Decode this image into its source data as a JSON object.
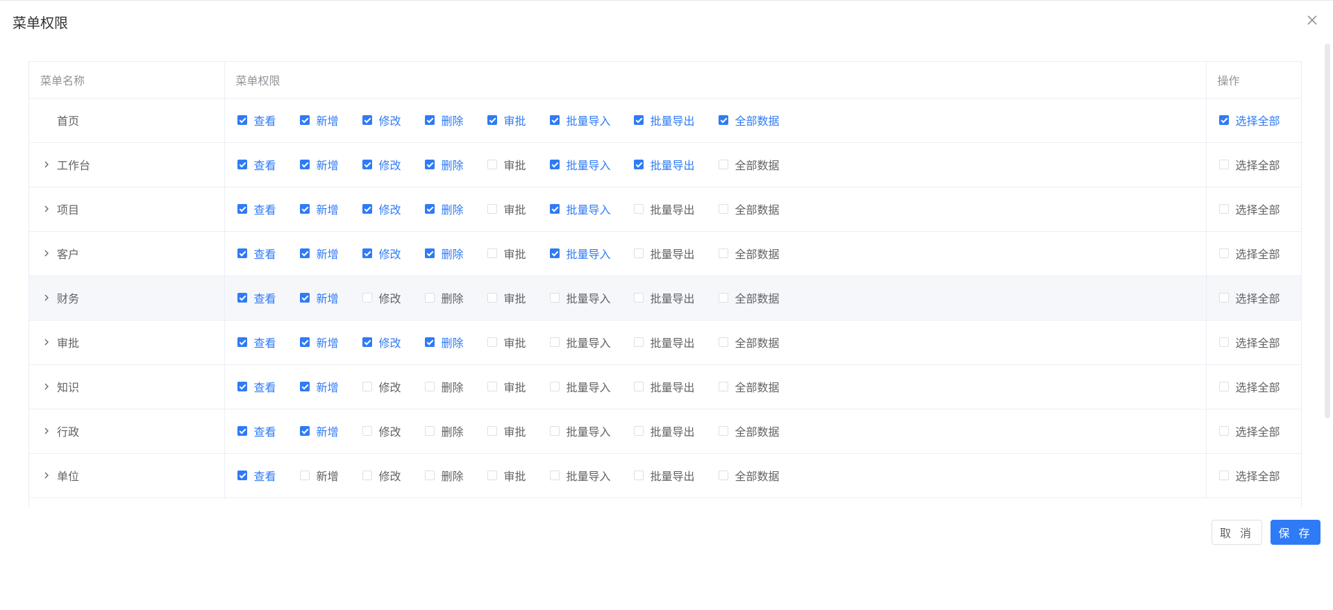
{
  "dialog": {
    "title": "菜单权限"
  },
  "table": {
    "headers": {
      "name": "菜单名称",
      "permissions": "菜单权限",
      "operation": "操作"
    },
    "perm_offsets": [
      0,
      90,
      180,
      270,
      360,
      450,
      571,
      693
    ],
    "rows": [
      {
        "name": "首页",
        "expandable": false,
        "highlight": false,
        "select_all": true,
        "perms": [
          {
            "label": "查看",
            "checked": true
          },
          {
            "label": "新增",
            "checked": true
          },
          {
            "label": "修改",
            "checked": true
          },
          {
            "label": "删除",
            "checked": true
          },
          {
            "label": "审批",
            "checked": true
          },
          {
            "label": "批量导入",
            "checked": true
          },
          {
            "label": "批量导出",
            "checked": true
          },
          {
            "label": "全部数据",
            "checked": true
          }
        ]
      },
      {
        "name": "工作台",
        "expandable": true,
        "highlight": false,
        "select_all": false,
        "perms": [
          {
            "label": "查看",
            "checked": true
          },
          {
            "label": "新增",
            "checked": true
          },
          {
            "label": "修改",
            "checked": true
          },
          {
            "label": "删除",
            "checked": true
          },
          {
            "label": "审批",
            "checked": false
          },
          {
            "label": "批量导入",
            "checked": true
          },
          {
            "label": "批量导出",
            "checked": true
          },
          {
            "label": "全部数据",
            "checked": false
          }
        ]
      },
      {
        "name": "项目",
        "expandable": true,
        "highlight": false,
        "select_all": false,
        "perms": [
          {
            "label": "查看",
            "checked": true
          },
          {
            "label": "新增",
            "checked": true
          },
          {
            "label": "修改",
            "checked": true
          },
          {
            "label": "删除",
            "checked": true
          },
          {
            "label": "审批",
            "checked": false
          },
          {
            "label": "批量导入",
            "checked": true
          },
          {
            "label": "批量导出",
            "checked": false
          },
          {
            "label": "全部数据",
            "checked": false
          }
        ]
      },
      {
        "name": "客户",
        "expandable": true,
        "highlight": false,
        "select_all": false,
        "perms": [
          {
            "label": "查看",
            "checked": true
          },
          {
            "label": "新增",
            "checked": true
          },
          {
            "label": "修改",
            "checked": true
          },
          {
            "label": "删除",
            "checked": true
          },
          {
            "label": "审批",
            "checked": false
          },
          {
            "label": "批量导入",
            "checked": true
          },
          {
            "label": "批量导出",
            "checked": false
          },
          {
            "label": "全部数据",
            "checked": false
          }
        ]
      },
      {
        "name": "财务",
        "expandable": true,
        "highlight": true,
        "select_all": false,
        "perms": [
          {
            "label": "查看",
            "checked": true
          },
          {
            "label": "新增",
            "checked": true
          },
          {
            "label": "修改",
            "checked": false
          },
          {
            "label": "删除",
            "checked": false
          },
          {
            "label": "审批",
            "checked": false
          },
          {
            "label": "批量导入",
            "checked": false
          },
          {
            "label": "批量导出",
            "checked": false
          },
          {
            "label": "全部数据",
            "checked": false
          }
        ]
      },
      {
        "name": "审批",
        "expandable": true,
        "highlight": false,
        "select_all": false,
        "perms": [
          {
            "label": "查看",
            "checked": true
          },
          {
            "label": "新增",
            "checked": true
          },
          {
            "label": "修改",
            "checked": true
          },
          {
            "label": "删除",
            "checked": true
          },
          {
            "label": "审批",
            "checked": false
          },
          {
            "label": "批量导入",
            "checked": false
          },
          {
            "label": "批量导出",
            "checked": false
          },
          {
            "label": "全部数据",
            "checked": false
          }
        ]
      },
      {
        "name": "知识",
        "expandable": true,
        "highlight": false,
        "select_all": false,
        "perms": [
          {
            "label": "查看",
            "checked": true
          },
          {
            "label": "新增",
            "checked": true
          },
          {
            "label": "修改",
            "checked": false
          },
          {
            "label": "删除",
            "checked": false
          },
          {
            "label": "审批",
            "checked": false
          },
          {
            "label": "批量导入",
            "checked": false
          },
          {
            "label": "批量导出",
            "checked": false
          },
          {
            "label": "全部数据",
            "checked": false
          }
        ]
      },
      {
        "name": "行政",
        "expandable": true,
        "highlight": false,
        "select_all": false,
        "perms": [
          {
            "label": "查看",
            "checked": true
          },
          {
            "label": "新增",
            "checked": true
          },
          {
            "label": "修改",
            "checked": false
          },
          {
            "label": "删除",
            "checked": false
          },
          {
            "label": "审批",
            "checked": false
          },
          {
            "label": "批量导入",
            "checked": false
          },
          {
            "label": "批量导出",
            "checked": false
          },
          {
            "label": "全部数据",
            "checked": false
          }
        ]
      },
      {
        "name": "单位",
        "expandable": true,
        "highlight": false,
        "select_all": false,
        "perms": [
          {
            "label": "查看",
            "checked": true
          },
          {
            "label": "新增",
            "checked": false
          },
          {
            "label": "修改",
            "checked": false
          },
          {
            "label": "删除",
            "checked": false
          },
          {
            "label": "审批",
            "checked": false
          },
          {
            "label": "批量导入",
            "checked": false
          },
          {
            "label": "批量导出",
            "checked": false
          },
          {
            "label": "全部数据",
            "checked": false
          }
        ]
      }
    ],
    "select_all_label": "选择全部"
  },
  "footer": {
    "cancel_label": "取 消",
    "save_label": "保 存"
  },
  "colors": {
    "primary": "#2f7bf6",
    "text": "#606266",
    "header_text": "#909399"
  },
  "icons": {
    "close": "close-icon",
    "expand": "chevron-right-icon"
  }
}
